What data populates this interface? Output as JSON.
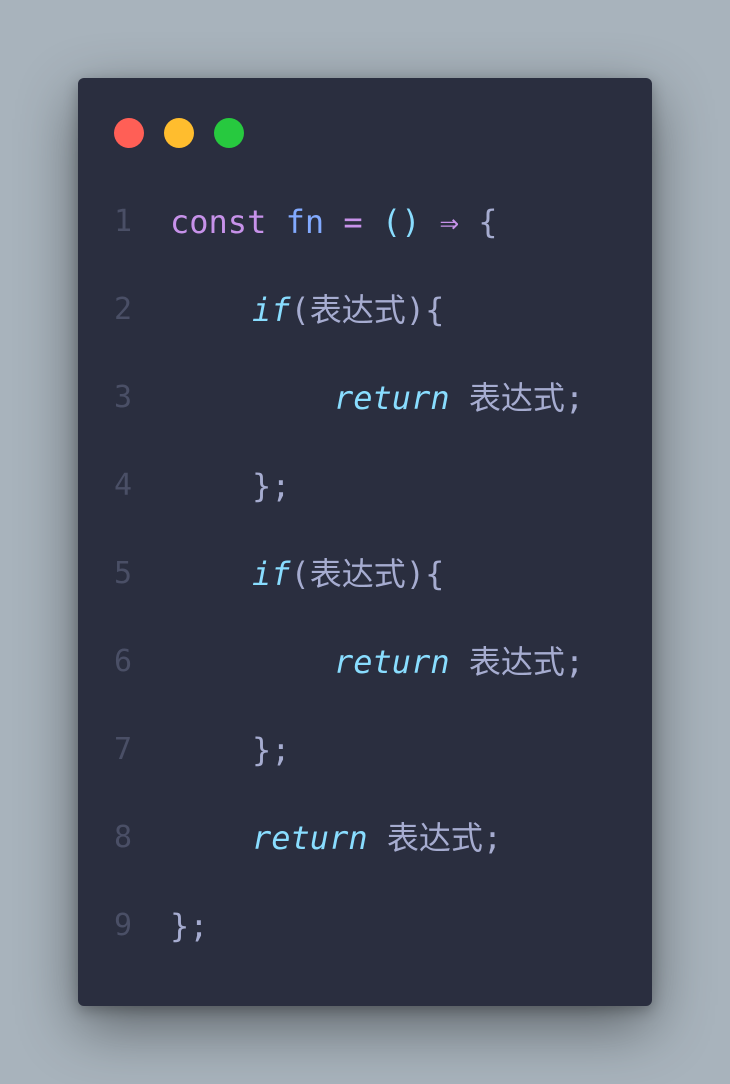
{
  "window": {
    "controls": [
      "close",
      "minimize",
      "maximize"
    ],
    "colors": {
      "close": "#ff5f56",
      "minimize": "#ffbd2e",
      "maximize": "#27c93f",
      "background": "#2a2e3f"
    }
  },
  "code": {
    "lines": [
      {
        "num": "1",
        "tokens": [
          {
            "t": "const",
            "c": "kw"
          },
          {
            "t": " ",
            "c": "txt"
          },
          {
            "t": "fn",
            "c": "fn"
          },
          {
            "t": " ",
            "c": "txt"
          },
          {
            "t": "=",
            "c": "kw"
          },
          {
            "t": " ",
            "c": "txt"
          },
          {
            "t": "()",
            "c": "punct"
          },
          {
            "t": " ",
            "c": "txt"
          },
          {
            "t": "⇒",
            "c": "kw"
          },
          {
            "t": " ",
            "c": "txt"
          },
          {
            "t": "{",
            "c": "txt"
          }
        ]
      },
      {
        "num": "2",
        "indent": 1,
        "tokens": [
          {
            "t": "if",
            "c": "ctrl"
          },
          {
            "t": "(表达式){",
            "c": "txt"
          }
        ]
      },
      {
        "num": "3",
        "indent": 2,
        "tokens": [
          {
            "t": "return",
            "c": "ctrl"
          },
          {
            "t": " 表达式;",
            "c": "txt"
          }
        ]
      },
      {
        "num": "4",
        "indent": 1,
        "tokens": [
          {
            "t": "};",
            "c": "txt"
          }
        ]
      },
      {
        "num": "5",
        "indent": 1,
        "tokens": [
          {
            "t": "if",
            "c": "ctrl"
          },
          {
            "t": "(表达式){",
            "c": "txt"
          }
        ]
      },
      {
        "num": "6",
        "indent": 2,
        "tokens": [
          {
            "t": "return",
            "c": "ctrl"
          },
          {
            "t": " 表达式;",
            "c": "txt"
          }
        ]
      },
      {
        "num": "7",
        "indent": 1,
        "tokens": [
          {
            "t": "};",
            "c": "txt"
          }
        ]
      },
      {
        "num": "8",
        "indent": 1,
        "tokens": [
          {
            "t": "return",
            "c": "ctrl"
          },
          {
            "t": " 表达式;",
            "c": "txt"
          }
        ]
      },
      {
        "num": "9",
        "tokens": [
          {
            "t": "};",
            "c": "txt"
          }
        ]
      }
    ]
  }
}
